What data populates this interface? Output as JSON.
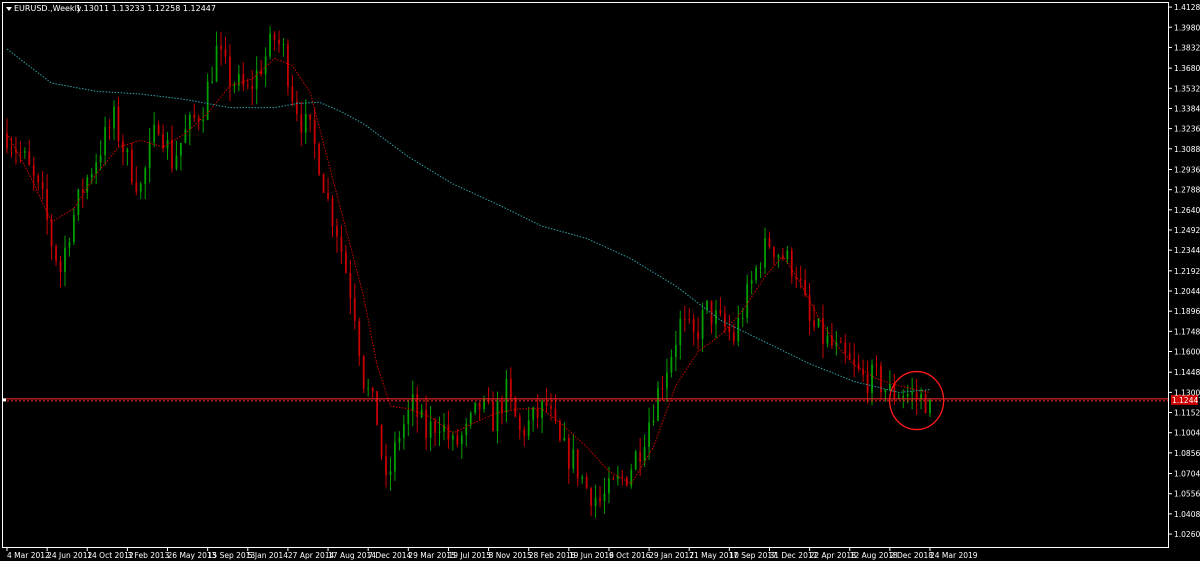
{
  "header": {
    "symbol": "EURUSD.,Weekly",
    "ohlc": "1.13011 1.13233 1.12258 1.12447"
  },
  "colors": {
    "background": "#000000",
    "frame": "#ffffff",
    "bull": "#00a000",
    "bear": "#c80000",
    "ma_fast": "#d40000",
    "ma_slow": "#2fa3a8",
    "price_line": "#ff2a2a",
    "annotation": "#ff1a1a"
  },
  "current_price_label": "1.12447",
  "chart_data": {
    "type": "candlestick",
    "title": "EURUSD.,Weekly",
    "y_axis": {
      "ylim": [
        1.0165,
        1.4158
      ],
      "ticks": [
        "1.41280",
        "1.39800",
        "1.38320",
        "1.36800",
        "1.35320",
        "1.33840",
        "1.32360",
        "1.30880",
        "1.29360",
        "1.27880",
        "1.26400",
        "1.24920",
        "1.23440",
        "1.21920",
        "1.20440",
        "1.18960",
        "1.17480",
        "1.16000",
        "1.14480",
        "1.13000",
        "1.11520",
        "1.10040",
        "1.08560",
        "1.07040",
        "1.05560",
        "1.04080",
        "1.02600"
      ]
    },
    "x_axis": {
      "labels": [
        "4 Mar 2012",
        "24 Jun 2012",
        "14 Oct 2012",
        "3 Feb 2013",
        "26 May 2013",
        "15 Sep 2013",
        "5 Jan 2014",
        "27 Apr 2014",
        "17 Aug 2014",
        "7 Dec 2014",
        "29 Mar 2015",
        "19 Jul 2015",
        "8 Nov 2015",
        "28 Feb 2016",
        "19 Jun 2016",
        "9 Oct 2016",
        "29 Jan 2017",
        "21 May 2017",
        "10 Sep 2017",
        "31 Dec 2017",
        "22 Apr 2018",
        "12 Aug 2018",
        "2 Dec 2018",
        "24 Mar 2019"
      ]
    },
    "price_path": [
      [
        0,
        1.32
      ],
      [
        4,
        1.3
      ],
      [
        8,
        1.27
      ],
      [
        10,
        1.24
      ],
      [
        12,
        1.22
      ],
      [
        14,
        1.25
      ],
      [
        17,
        1.28
      ],
      [
        21,
        1.31
      ],
      [
        24,
        1.33
      ],
      [
        27,
        1.3
      ],
      [
        30,
        1.28
      ],
      [
        34,
        1.33
      ],
      [
        37,
        1.3
      ],
      [
        40,
        1.32
      ],
      [
        44,
        1.34
      ],
      [
        47,
        1.38
      ],
      [
        50,
        1.36
      ],
      [
        54,
        1.35
      ],
      [
        57,
        1.37
      ],
      [
        60,
        1.39
      ],
      [
        62,
        1.38
      ],
      [
        64,
        1.35
      ],
      [
        66,
        1.33
      ],
      [
        68,
        1.32
      ],
      [
        70,
        1.3
      ],
      [
        72,
        1.27
      ],
      [
        74,
        1.25
      ],
      [
        76,
        1.22
      ],
      [
        78,
        1.19
      ],
      [
        80,
        1.14
      ],
      [
        83,
        1.11
      ],
      [
        85,
        1.06
      ],
      [
        88,
        1.1
      ],
      [
        91,
        1.12
      ],
      [
        94,
        1.1
      ],
      [
        97,
        1.11
      ],
      [
        100,
        1.09
      ],
      [
        103,
        1.1
      ],
      [
        106,
        1.12
      ],
      [
        109,
        1.11
      ],
      [
        112,
        1.13
      ],
      [
        115,
        1.1
      ],
      [
        118,
        1.11
      ],
      [
        121,
        1.12
      ],
      [
        124,
        1.09
      ],
      [
        127,
        1.08
      ],
      [
        130,
        1.06
      ],
      [
        133,
        1.05
      ],
      [
        136,
        1.06
      ],
      [
        139,
        1.07
      ],
      [
        142,
        1.09
      ],
      [
        145,
        1.12
      ],
      [
        148,
        1.15
      ],
      [
        151,
        1.18
      ],
      [
        154,
        1.17
      ],
      [
        157,
        1.19
      ],
      [
        160,
        1.18
      ],
      [
        163,
        1.17
      ],
      [
        166,
        1.2
      ],
      [
        169,
        1.23
      ],
      [
        171,
        1.24
      ],
      [
        174,
        1.23
      ],
      [
        177,
        1.22
      ],
      [
        180,
        1.18
      ],
      [
        183,
        1.17
      ],
      [
        186,
        1.16
      ],
      [
        189,
        1.15
      ],
      [
        192,
        1.14
      ],
      [
        195,
        1.14
      ],
      [
        198,
        1.13
      ],
      [
        201,
        1.13
      ],
      [
        204,
        1.126
      ],
      [
        207,
        1.124
      ]
    ],
    "last_close": 1.12447,
    "indicators": [
      {
        "type": "moving_average",
        "style": "dotted",
        "color": "#d40000",
        "points": [
          [
            0,
            1.32
          ],
          [
            5,
            1.29
          ],
          [
            10,
            1.255
          ],
          [
            15,
            1.265
          ],
          [
            20,
            1.29
          ],
          [
            25,
            1.31
          ],
          [
            30,
            1.315
          ],
          [
            35,
            1.31
          ],
          [
            40,
            1.32
          ],
          [
            45,
            1.335
          ],
          [
            50,
            1.355
          ],
          [
            55,
            1.36
          ],
          [
            60,
            1.375
          ],
          [
            64,
            1.37
          ],
          [
            68,
            1.35
          ],
          [
            72,
            1.3
          ],
          [
            76,
            1.25
          ],
          [
            80,
            1.2
          ],
          [
            83,
            1.15
          ],
          [
            86,
            1.12
          ],
          [
            90,
            1.118
          ],
          [
            95,
            1.112
          ],
          [
            100,
            1.1
          ],
          [
            105,
            1.108
          ],
          [
            110,
            1.115
          ],
          [
            115,
            1.118
          ],
          [
            120,
            1.118
          ],
          [
            125,
            1.105
          ],
          [
            130,
            1.09
          ],
          [
            135,
            1.072
          ],
          [
            140,
            1.063
          ],
          [
            145,
            1.09
          ],
          [
            150,
            1.135
          ],
          [
            155,
            1.16
          ],
          [
            160,
            1.172
          ],
          [
            165,
            1.19
          ],
          [
            170,
            1.215
          ],
          [
            174,
            1.23
          ],
          [
            178,
            1.21
          ],
          [
            182,
            1.185
          ],
          [
            186,
            1.165
          ],
          [
            190,
            1.15
          ],
          [
            195,
            1.14
          ],
          [
            200,
            1.135
          ],
          [
            205,
            1.131
          ],
          [
            207,
            1.13
          ]
        ]
      },
      {
        "type": "moving_average",
        "style": "dotted",
        "color": "#2fa3a8",
        "points": [
          [
            0,
            1.382
          ],
          [
            10,
            1.357
          ],
          [
            20,
            1.351
          ],
          [
            30,
            1.349
          ],
          [
            40,
            1.345
          ],
          [
            50,
            1.339
          ],
          [
            60,
            1.339
          ],
          [
            65,
            1.342
          ],
          [
            70,
            1.343
          ],
          [
            75,
            1.336
          ],
          [
            80,
            1.327
          ],
          [
            90,
            1.303
          ],
          [
            100,
            1.283
          ],
          [
            110,
            1.268
          ],
          [
            120,
            1.252
          ],
          [
            130,
            1.243
          ],
          [
            140,
            1.228
          ],
          [
            150,
            1.208
          ],
          [
            160,
            1.183
          ],
          [
            170,
            1.167
          ],
          [
            180,
            1.151
          ],
          [
            190,
            1.138
          ],
          [
            200,
            1.13
          ],
          [
            207,
            1.132
          ]
        ]
      }
    ],
    "annotations": [
      {
        "type": "horizontal_line",
        "y": 1.12447
      },
      {
        "type": "circle",
        "center_x": 204,
        "center_y": 1.124,
        "shape": "hand-drawn circle around the latest candles"
      }
    ]
  }
}
